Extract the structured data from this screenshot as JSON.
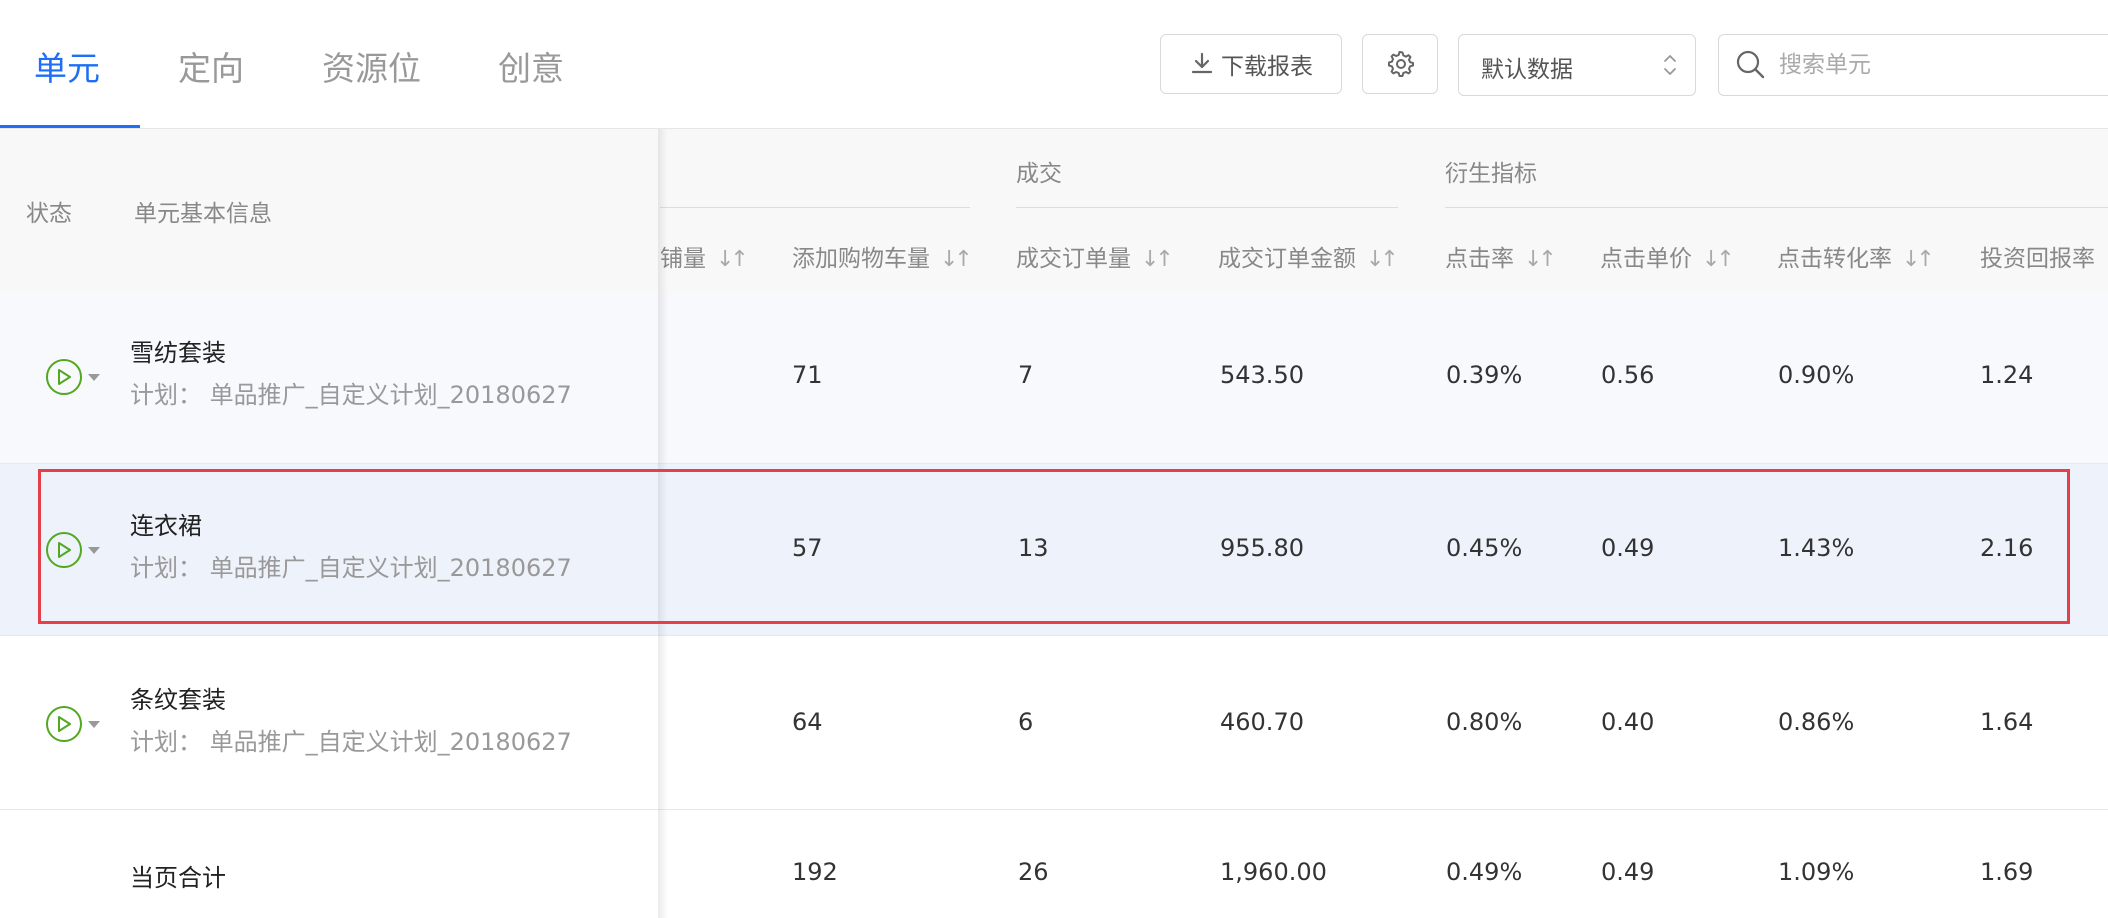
{
  "tabs": [
    {
      "label": "单元",
      "active": true
    },
    {
      "label": "定向",
      "active": false
    },
    {
      "label": "资源位",
      "active": false
    },
    {
      "label": "创意",
      "active": false
    }
  ],
  "toolbar": {
    "download_label": "下载报表",
    "data_select_value": "默认数据",
    "search_placeholder": "搜索单元"
  },
  "table": {
    "fixed_headers": {
      "status": "状态",
      "info": "单元基本信息"
    },
    "groups": {
      "deal": "成交",
      "derived": "衍生指标"
    },
    "columns": [
      "铺量",
      "添加购物车量",
      "成交订单量",
      "成交订单金额",
      "点击率",
      "点击单价",
      "点击转化率",
      "投资回报率"
    ],
    "rows": [
      {
        "name": "雪纺套装",
        "plan": "计划：  单品推广_自定义计划_20180627",
        "values": [
          "71",
          "7",
          "543.50",
          "0.39%",
          "0.56",
          "0.90%",
          "1.24"
        ]
      },
      {
        "name": "连衣裙",
        "plan": "计划：  单品推广_自定义计划_20180627",
        "values": [
          "57",
          "13",
          "955.80",
          "0.45%",
          "0.49",
          "1.43%",
          "2.16"
        ]
      },
      {
        "name": "条纹套装",
        "plan": "计划：  单品推广_自定义计划_20180627",
        "values": [
          "64",
          "6",
          "460.70",
          "0.80%",
          "0.40",
          "0.86%",
          "1.64"
        ]
      }
    ],
    "total": {
      "label": "当页合计",
      "values": [
        "192",
        "26",
        "1,960.00",
        "0.49%",
        "0.49",
        "1.09%",
        "1.69"
      ]
    }
  },
  "colors": {
    "accent": "#1e6ff5",
    "status_green": "#52a820",
    "highlight": "#e5404a"
  },
  "icons": {
    "download": "download-icon",
    "settings": "gear-icon",
    "select": "updown-chevron-icon",
    "search": "search-icon",
    "status": "play-circle-icon"
  }
}
